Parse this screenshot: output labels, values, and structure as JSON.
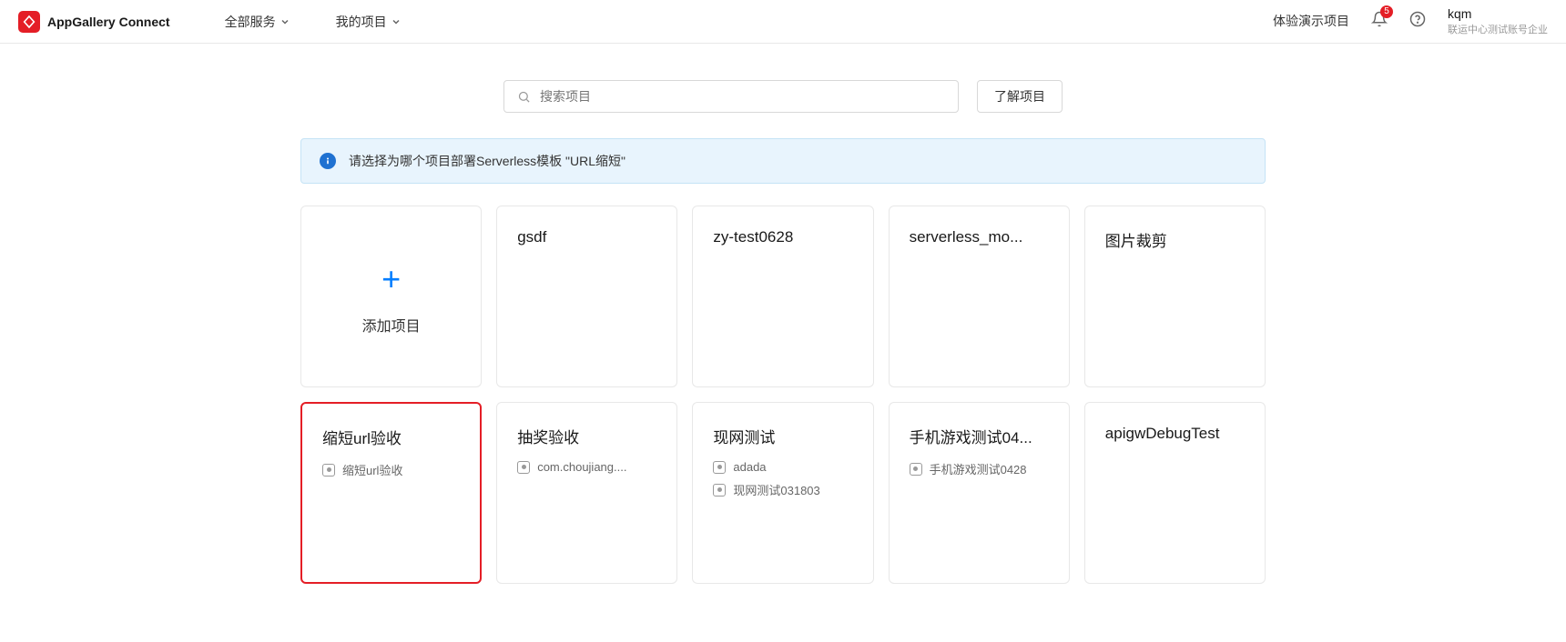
{
  "header": {
    "brand": "AppGallery Connect",
    "nav": {
      "all_services": "全部服务",
      "my_projects": "我的项目"
    },
    "demo_link": "体验演示项目",
    "bell_badge": "5",
    "user": {
      "name": "kqm",
      "org": "联运中心测试账号企业"
    }
  },
  "search": {
    "placeholder": "搜索项目",
    "learn_button": "了解项目"
  },
  "banner": {
    "text": "请选择为哪个项目部署Serverless模板 \"URL缩短\""
  },
  "add_card": {
    "label": "添加项目"
  },
  "projects": [
    {
      "title": "gsdf",
      "subs": []
    },
    {
      "title": "zy-test0628",
      "subs": []
    },
    {
      "title": "serverless_mo...",
      "subs": []
    },
    {
      "title": "图片裁剪",
      "subs": []
    },
    {
      "title": "缩短url验收",
      "subs": [
        "缩短url验收"
      ],
      "highlighted": true
    },
    {
      "title": "抽奖验收",
      "subs": [
        "com.choujiang...."
      ]
    },
    {
      "title": "现网测试",
      "subs": [
        "adada",
        "现网测试031803"
      ]
    },
    {
      "title": "手机游戏测试04...",
      "subs": [
        "手机游戏测试0428"
      ]
    },
    {
      "title": "apigwDebugTest",
      "subs": []
    }
  ]
}
